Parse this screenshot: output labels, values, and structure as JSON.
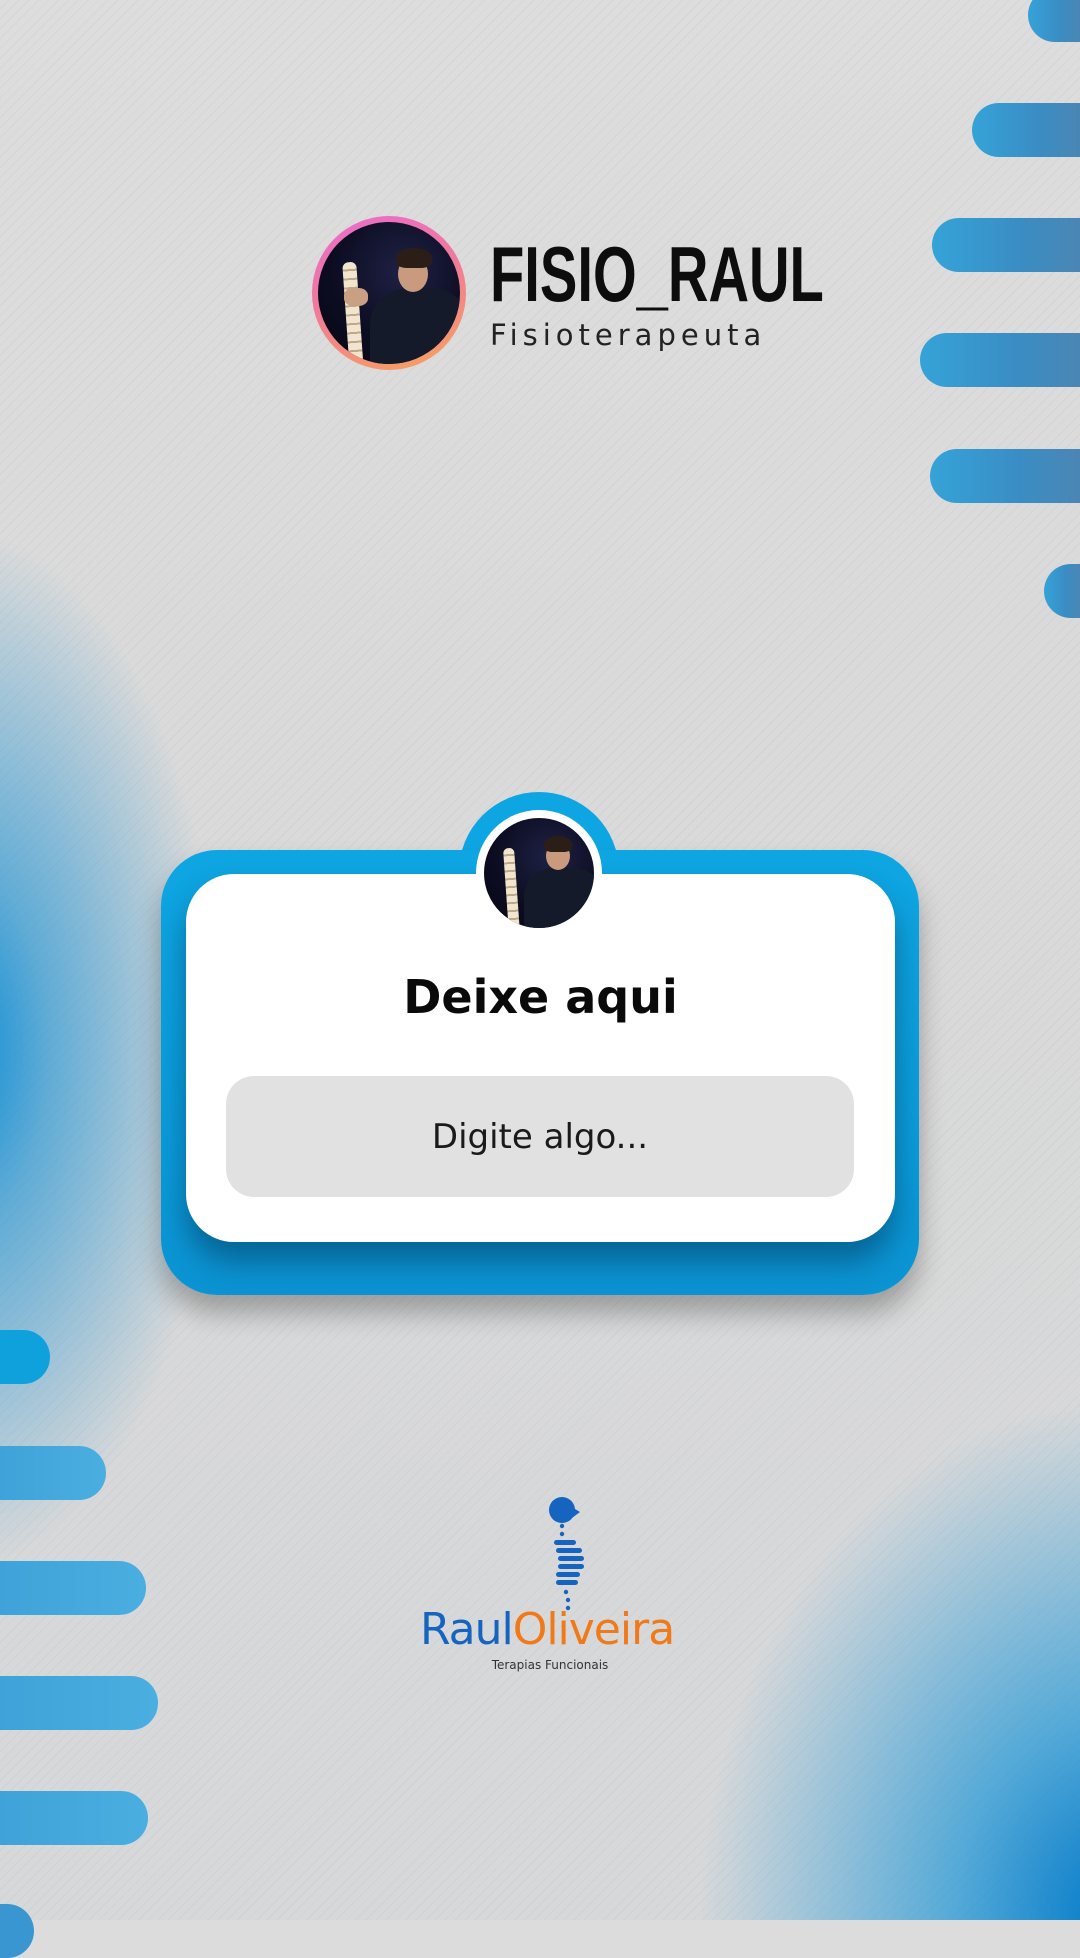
{
  "profile": {
    "username": "FISIO_RAUL",
    "role": "Fisioterapeuta"
  },
  "card": {
    "title": "Deixe aqui",
    "input_placeholder": "Digite algo...",
    "input_value": ""
  },
  "logo": {
    "first_name": "Raul",
    "last_name": "Oliveira",
    "tagline": "Terapias Funcionais"
  },
  "colors": {
    "card_blue": "#0ea6e2",
    "logo_blue": "#1565c0",
    "logo_orange": "#f07a1a",
    "avatar_ring_gradient": [
      "#e96bd0",
      "#f7a45a"
    ]
  },
  "icons": {
    "profile_avatar": "avatar-photo",
    "card_avatar": "avatar-photo",
    "logo_mark": "spine-head-logo-icon"
  }
}
